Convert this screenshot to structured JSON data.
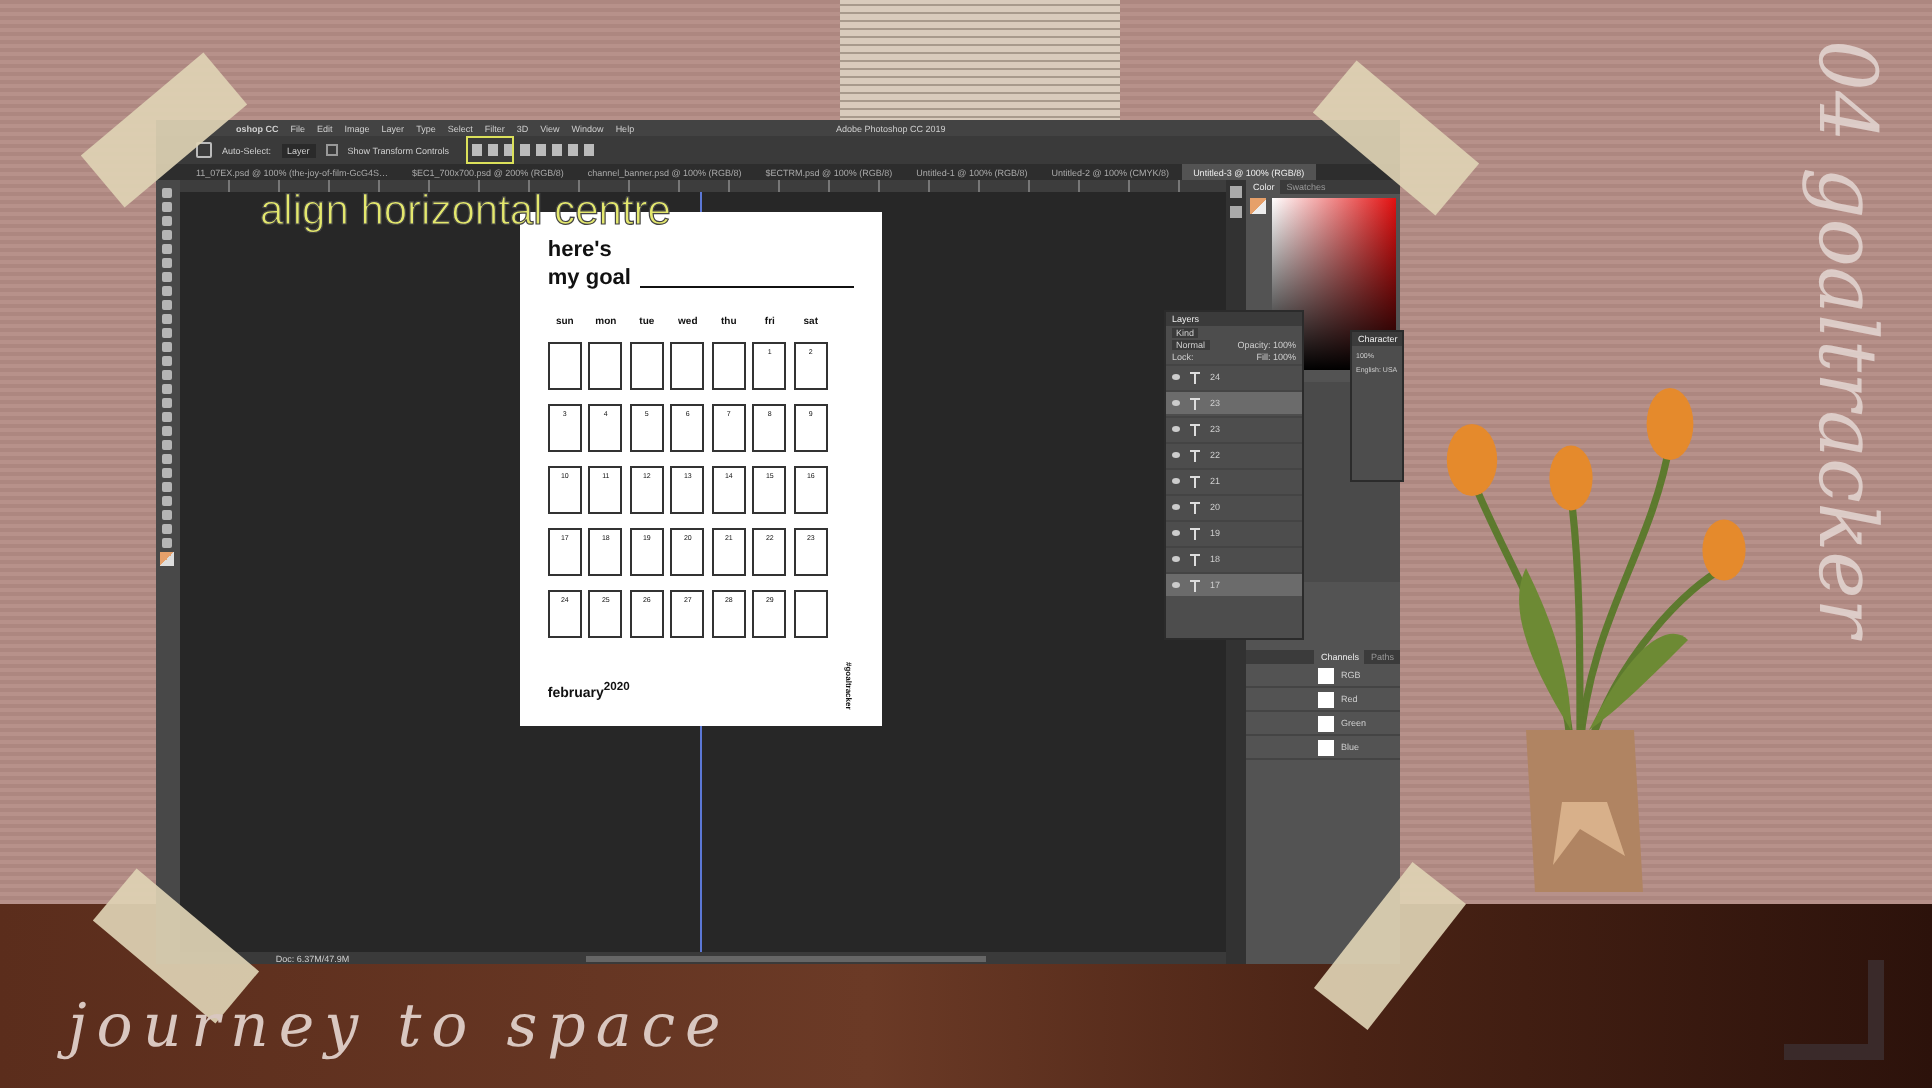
{
  "caption": "align horizontal centre",
  "photoshop": {
    "app_name": "oshop CC",
    "menus": [
      "File",
      "Edit",
      "Image",
      "Layer",
      "Type",
      "Select",
      "Filter",
      "3D",
      "View",
      "Window",
      "Help"
    ],
    "title": "Adobe Photoshop CC 2019",
    "options": {
      "auto_select": "Auto-Select:",
      "layer": "Layer",
      "show_transform": "Show Transform Controls",
      "show_transform_checked": false
    },
    "doc_tabs": [
      {
        "label": "11_07EX.psd @ 100% (the-joy-of-film-GcG4S…",
        "selected": false
      },
      {
        "label": "$EC1_700x700.psd @ 200% (RGB/8)",
        "selected": false
      },
      {
        "label": "channel_banner.psd @ 100% (RGB/8)",
        "selected": false
      },
      {
        "label": "$ECTRM.psd @ 100% (RGB/8)",
        "selected": false
      },
      {
        "label": "Untitled-1 @ 100% (RGB/8)",
        "selected": false
      },
      {
        "label": "Untitled-2 @ 100% (CMYK/8)",
        "selected": false
      },
      {
        "label": "Untitled-3 @ 100% (RGB/8)",
        "selected": true
      }
    ],
    "status": "Doc: 6.37M/47.9M",
    "color_panel": {
      "tabs": [
        {
          "label": "Color",
          "selected": true
        },
        {
          "label": "Swatches",
          "selected": false
        }
      ]
    },
    "layers_panel": {
      "title": "Layers",
      "kind": "Kind",
      "blend_mode": "Normal",
      "opacity": "Opacity: 100%",
      "lock": "Lock:",
      "fill": "Fill: 100%",
      "layers": [
        {
          "name": "24",
          "selected": false
        },
        {
          "name": "23",
          "selected": true
        },
        {
          "name": "23",
          "selected": false
        },
        {
          "name": "22",
          "selected": false
        },
        {
          "name": "21",
          "selected": false
        },
        {
          "name": "20",
          "selected": false
        },
        {
          "name": "19",
          "selected": false
        },
        {
          "name": "18",
          "selected": false
        },
        {
          "name": "17",
          "selected": true
        }
      ]
    },
    "character_panel": {
      "title": "Character",
      "size": "100%",
      "language": "English: USA"
    },
    "channels_panel": {
      "tabs": [
        {
          "label": "Channels",
          "selected": true
        },
        {
          "label": "Paths",
          "selected": false
        }
      ],
      "channels": [
        "RGB",
        "Red",
        "Green",
        "Blue"
      ]
    }
  },
  "document": {
    "heading_1": "here's",
    "heading_2": "my goal",
    "days": [
      "sun",
      "mon",
      "tue",
      "wed",
      "thu",
      "fri",
      "sat"
    ],
    "weeks": [
      [
        {
          "kind": "blank"
        },
        {
          "kind": "blank"
        },
        {
          "kind": "blank"
        },
        {
          "kind": "blank"
        },
        {
          "kind": "blank"
        },
        {
          "kind": "date",
          "date": "1"
        },
        {
          "kind": "date",
          "date": "2"
        }
      ],
      [
        {
          "kind": "date",
          "date": "3"
        },
        {
          "kind": "date",
          "date": "4"
        },
        {
          "kind": "date",
          "date": "5"
        },
        {
          "kind": "date",
          "date": "6"
        },
        {
          "kind": "date",
          "date": "7"
        },
        {
          "kind": "date",
          "date": "8"
        },
        {
          "kind": "date",
          "date": "9"
        }
      ],
      [
        {
          "kind": "date",
          "date": "10"
        },
        {
          "kind": "date",
          "date": "11"
        },
        {
          "kind": "date",
          "date": "12"
        },
        {
          "kind": "date",
          "date": "13"
        },
        {
          "kind": "date",
          "date": "14"
        },
        {
          "kind": "date",
          "date": "15"
        },
        {
          "kind": "date",
          "date": "16"
        }
      ],
      [
        {
          "kind": "date",
          "date": "17"
        },
        {
          "kind": "date",
          "date": "18"
        },
        {
          "kind": "date",
          "date": "19"
        },
        {
          "kind": "date",
          "date": "20"
        },
        {
          "kind": "date",
          "date": "21"
        },
        {
          "kind": "date",
          "date": "22"
        },
        {
          "kind": "date",
          "date": "23"
        }
      ],
      [
        {
          "kind": "date",
          "date": "24"
        },
        {
          "kind": "date",
          "date": "25"
        },
        {
          "kind": "date",
          "date": "26"
        },
        {
          "kind": "date",
          "date": "27"
        },
        {
          "kind": "date",
          "date": "28"
        },
        {
          "kind": "date",
          "date": "29"
        },
        {
          "kind": "blank"
        }
      ]
    ],
    "month": "february$^{2020}$",
    "hashtag": "#goaltracker"
  },
  "decor": {
    "title_script": "journey to space",
    "series_script": "04 goaltracker"
  }
}
